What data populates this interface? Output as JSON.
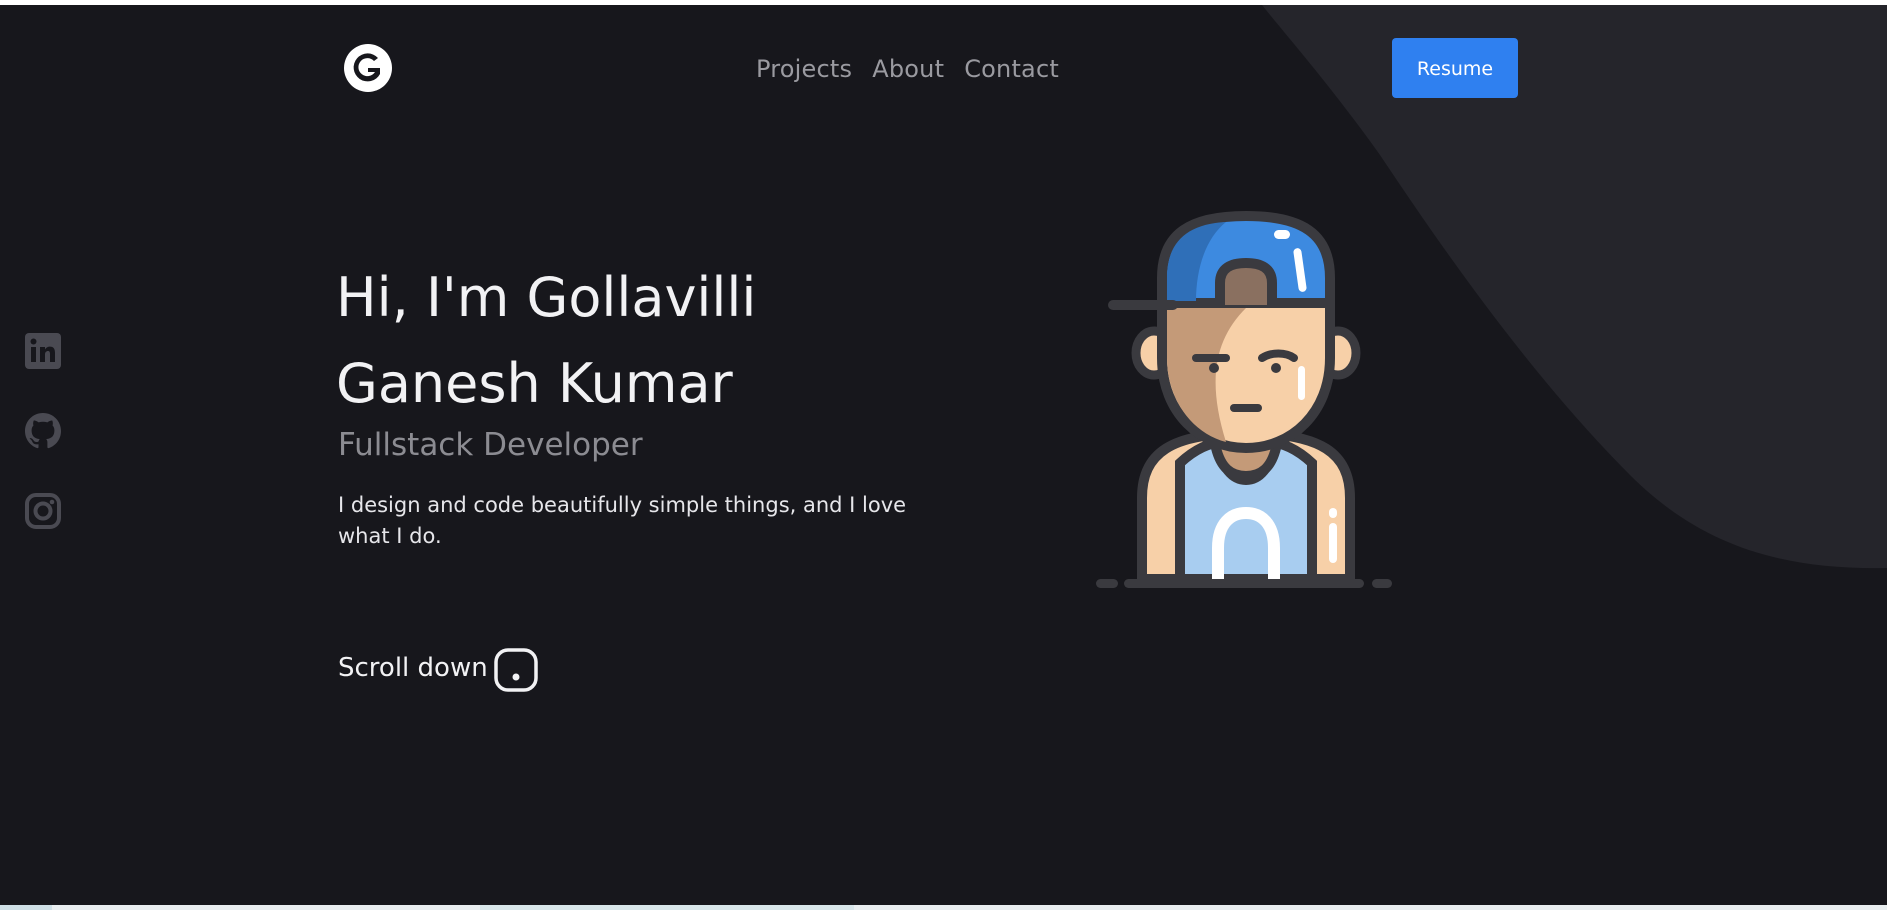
{
  "header": {
    "logo_icon": "g-logo-icon",
    "nav": {
      "projects": "Projects",
      "about": "About",
      "contact": "Contact"
    },
    "resume_label": "Resume"
  },
  "social": [
    {
      "icon": "linkedin-icon"
    },
    {
      "icon": "github-icon"
    },
    {
      "icon": "instagram-icon"
    }
  ],
  "hero": {
    "title": "Hi, I'm Gollavilli Ganesh Kumar",
    "role": "Fullstack Developer",
    "description": "I design and code beautifully simple things, and I love what I do.",
    "scroll_label": "Scroll down",
    "scroll_icon": "mouse-icon",
    "avatar": "developer-avatar-illustration"
  },
  "colors": {
    "background": "#17171c",
    "accent_shape": "#25252b",
    "button": "#2f80f0",
    "text": "#f2f2f4",
    "muted": "#8c8c92"
  }
}
